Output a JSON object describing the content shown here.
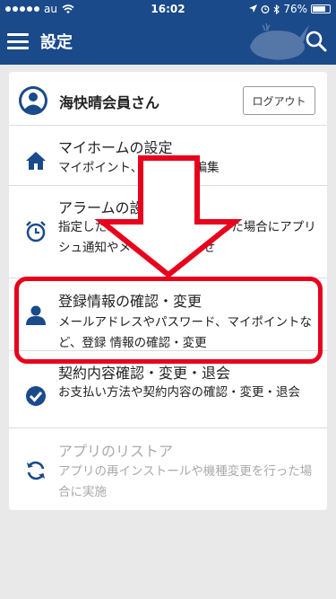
{
  "status_bar": {
    "carrier": "au",
    "time": "16:02",
    "battery": "76%"
  },
  "header": {
    "title": "設定"
  },
  "member": {
    "name": "海快晴会員さん",
    "logout_label": "ログアウト"
  },
  "menu": [
    {
      "title": "マイホームの設定",
      "desc": "マイポイント、ス ールの編集",
      "disabled": false
    },
    {
      "title": "アラームの設",
      "desc": "指定したエリ ィションが変化した場合にアプリ シュ通知やメールでお知らせ",
      "disabled": false
    },
    {
      "title": "登録情報の確認・変更",
      "desc": "メールアドレスやパスワード、マイポイントなど、登録 情報の確認・変更",
      "disabled": false
    },
    {
      "title": "契約内容確認・変更・退会",
      "desc": "お支払い方法や契約内容の確認・変更・退会",
      "disabled": false
    },
    {
      "title": "アプリのリストア",
      "desc": "アプリの再インストールや機種変更を行った場合に実施",
      "disabled": true
    }
  ],
  "colors": {
    "header_bg": "#1a4a8a",
    "icon_blue": "#1a4a8a",
    "annotation_red": "#e8001c",
    "disabled_gray": "#aaaaaa"
  },
  "icons": {
    "menu": [
      "home-icon",
      "alarm-clock-icon",
      "person-icon",
      "check-circle-icon",
      "refresh-icon"
    ]
  }
}
